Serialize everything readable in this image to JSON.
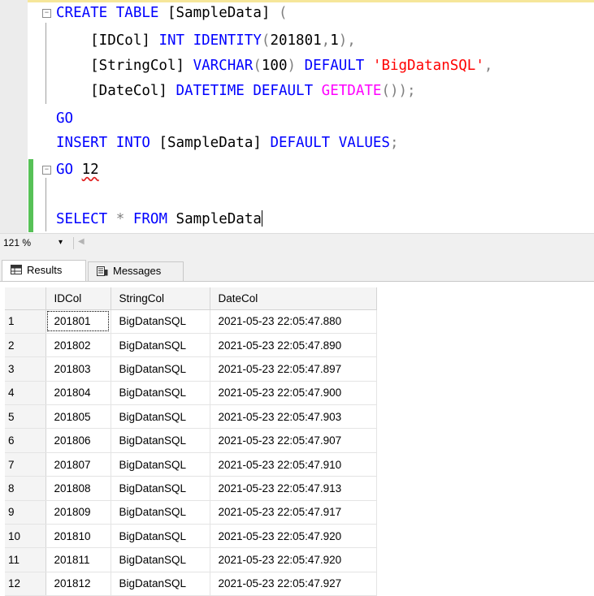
{
  "editor": {
    "lines": [
      {
        "fold": "minus",
        "tokens": [
          {
            "t": "CREATE",
            "c": "kw"
          },
          {
            "t": " ",
            "c": "txt"
          },
          {
            "t": "TABLE",
            "c": "kw"
          },
          {
            "t": " [SampleData] ",
            "c": "txt"
          },
          {
            "t": "(",
            "c": "op"
          }
        ]
      },
      {
        "tokens": [
          {
            "t": "    [IDCol] ",
            "c": "txt"
          },
          {
            "t": "INT",
            "c": "kw"
          },
          {
            "t": " ",
            "c": "txt"
          },
          {
            "t": "IDENTITY",
            "c": "kw"
          },
          {
            "t": "(",
            "c": "op"
          },
          {
            "t": "201801",
            "c": "num"
          },
          {
            "t": ",",
            "c": "op"
          },
          {
            "t": "1",
            "c": "num"
          },
          {
            "t": "),",
            "c": "op"
          }
        ]
      },
      {
        "tokens": [
          {
            "t": "    [StringCol] ",
            "c": "txt"
          },
          {
            "t": "VARCHAR",
            "c": "kw"
          },
          {
            "t": "(",
            "c": "op"
          },
          {
            "t": "100",
            "c": "num"
          },
          {
            "t": ")",
            "c": "op"
          },
          {
            "t": " ",
            "c": "txt"
          },
          {
            "t": "DEFAULT",
            "c": "kw"
          },
          {
            "t": " ",
            "c": "txt"
          },
          {
            "t": "'BigDatanSQL'",
            "c": "str"
          },
          {
            "t": ",",
            "c": "op"
          }
        ]
      },
      {
        "tokens": [
          {
            "t": "    [DateCol] ",
            "c": "txt"
          },
          {
            "t": "DATETIME",
            "c": "kw"
          },
          {
            "t": " ",
            "c": "txt"
          },
          {
            "t": "DEFAULT",
            "c": "kw"
          },
          {
            "t": " ",
            "c": "txt"
          },
          {
            "t": "GETDATE",
            "c": "fn"
          },
          {
            "t": "());",
            "c": "op"
          }
        ]
      },
      {
        "tokens": [
          {
            "t": "GO",
            "c": "kw"
          }
        ]
      },
      {
        "tokens": [
          {
            "t": "INSERT",
            "c": "kw"
          },
          {
            "t": " ",
            "c": "txt"
          },
          {
            "t": "INTO",
            "c": "kw"
          },
          {
            "t": " [SampleData] ",
            "c": "txt"
          },
          {
            "t": "DEFAULT",
            "c": "kw"
          },
          {
            "t": " ",
            "c": "txt"
          },
          {
            "t": "VALUES",
            "c": "kw"
          },
          {
            "t": ";",
            "c": "op"
          }
        ]
      },
      {
        "fold": "minus",
        "tokens": [
          {
            "t": "GO",
            "c": "kw"
          },
          {
            "t": " ",
            "c": "txt"
          },
          {
            "t": "12",
            "c": "num sq"
          }
        ]
      },
      {
        "tokens": []
      },
      {
        "caret": true,
        "tokens": [
          {
            "t": "SELECT",
            "c": "kw"
          },
          {
            "t": " ",
            "c": "txt"
          },
          {
            "t": "*",
            "c": "op"
          },
          {
            "t": " ",
            "c": "txt"
          },
          {
            "t": "FROM",
            "c": "kw"
          },
          {
            "t": " SampleData",
            "c": "txt"
          }
        ]
      }
    ]
  },
  "zoom": {
    "level": "121 %",
    "dropdown_icon": "triangle-down-icon"
  },
  "tabs": [
    {
      "label": "Results",
      "icon": "grid-icon",
      "active": true
    },
    {
      "label": "Messages",
      "icon": "messages-icon",
      "active": false
    }
  ],
  "grid": {
    "columns": [
      "IDCol",
      "StringCol",
      "DateCol"
    ],
    "rows": [
      [
        "1",
        "201801",
        "BigDatanSQL",
        "2021-05-23 22:05:47.880"
      ],
      [
        "2",
        "201802",
        "BigDatanSQL",
        "2021-05-23 22:05:47.890"
      ],
      [
        "3",
        "201803",
        "BigDatanSQL",
        "2021-05-23 22:05:47.897"
      ],
      [
        "4",
        "201804",
        "BigDatanSQL",
        "2021-05-23 22:05:47.900"
      ],
      [
        "5",
        "201805",
        "BigDatanSQL",
        "2021-05-23 22:05:47.903"
      ],
      [
        "6",
        "201806",
        "BigDatanSQL",
        "2021-05-23 22:05:47.907"
      ],
      [
        "7",
        "201807",
        "BigDatanSQL",
        "2021-05-23 22:05:47.910"
      ],
      [
        "8",
        "201808",
        "BigDatanSQL",
        "2021-05-23 22:05:47.913"
      ],
      [
        "9",
        "201809",
        "BigDatanSQL",
        "2021-05-23 22:05:47.917"
      ],
      [
        "10",
        "201810",
        "BigDatanSQL",
        "2021-05-23 22:05:47.920"
      ],
      [
        "11",
        "201811",
        "BigDatanSQL",
        "2021-05-23 22:05:47.920"
      ],
      [
        "12",
        "201812",
        "BigDatanSQL",
        "2021-05-23 22:05:47.927"
      ]
    ]
  },
  "colors": {
    "keyword": "#0000ff",
    "function": "#ff00ff",
    "string": "#ff0000",
    "operator": "#808080",
    "change_bar": "#57c157"
  }
}
